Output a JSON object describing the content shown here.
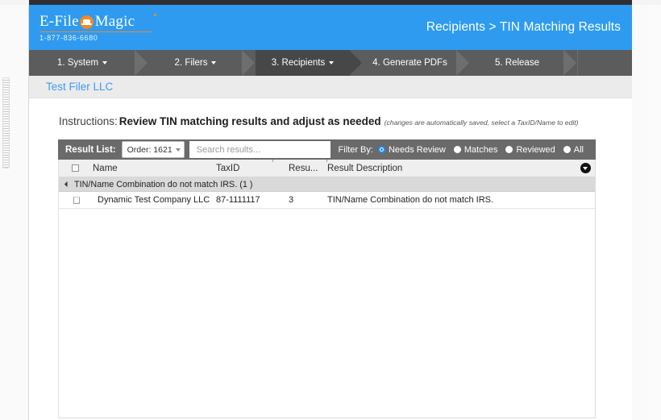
{
  "header": {
    "logo": {
      "part1": "E-",
      "part2": "File",
      "part3": "Magic",
      "icon": "magician-hat-icon",
      "phone": "1-877-836-6680"
    },
    "title": "Recipients > TIN Matching Results",
    "brand_color": "#2e9bf0",
    "accent_color": "#f0882a"
  },
  "wizard": {
    "steps": [
      {
        "label": "1. System",
        "has_caret": true,
        "active": false
      },
      {
        "label": "2. Filers",
        "has_caret": true,
        "active": false
      },
      {
        "label": "3. Recipients",
        "has_caret": true,
        "active": true
      },
      {
        "label": "4. Generate PDFs",
        "has_caret": false,
        "active": false
      },
      {
        "label": "5. Release",
        "has_caret": false,
        "active": false
      }
    ]
  },
  "filer": {
    "name": "Test Filer LLC"
  },
  "instructions": {
    "label": "Instructions:",
    "main": "Review TIN matching results and adjust as needed",
    "note": "(changes are automatically saved, select a TaxID/Name to edit)"
  },
  "toolbar": {
    "result_list_label": "Result List:",
    "order_select_value": "Order: 1621",
    "order_options": [
      "Order: 1621"
    ],
    "search_placeholder": "Search results...",
    "search_value": "",
    "filter_by_label": "Filter By:",
    "filters": [
      {
        "label": "Needs Review",
        "selected": true
      },
      {
        "label": "Matches",
        "selected": false
      },
      {
        "label": "Reviewed",
        "selected": false
      },
      {
        "label": "All",
        "selected": false
      }
    ]
  },
  "grid": {
    "columns": [
      {
        "key": "check",
        "label": ""
      },
      {
        "key": "name",
        "label": "Name"
      },
      {
        "key": "taxid",
        "label": "TaxID"
      },
      {
        "key": "result",
        "label": "Resu..."
      },
      {
        "key": "description",
        "label": "Result Description"
      }
    ],
    "menu_icon": "grid-menu-icon",
    "groups": [
      {
        "title": "TIN/Name Combination do not match IRS. (1 )",
        "expanded": true,
        "rows": [
          {
            "checked": false,
            "name": "Dynamic Test Company LLC",
            "taxid": "87-1111117",
            "result": "3",
            "description": "TIN/Name Combination do not match IRS."
          }
        ]
      }
    ]
  }
}
